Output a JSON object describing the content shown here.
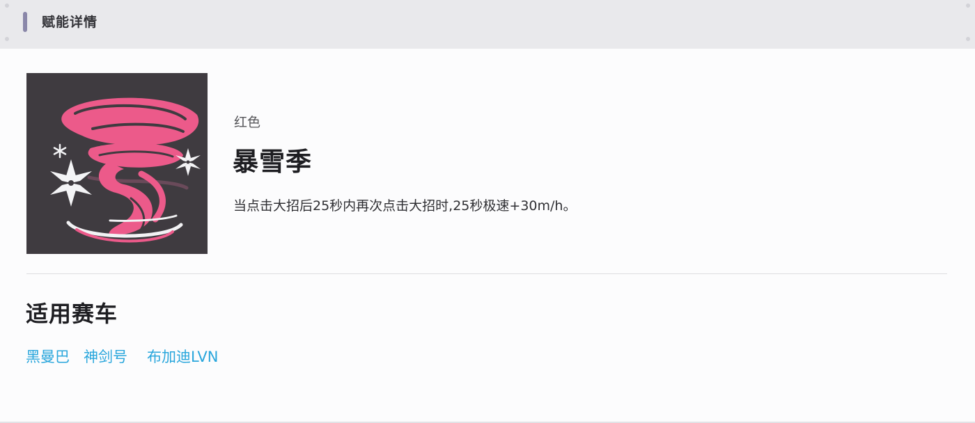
{
  "header": {
    "title": "赋能详情"
  },
  "ability": {
    "icon": "pink-tornado-snowflake-icon",
    "rarity": "红色",
    "name": "暴雪季",
    "description": "当点击大招后25秒内再次点击大招时,25秒极速+30m/h。"
  },
  "applicable_cars": {
    "title": "适用赛车",
    "cars": [
      "黑曼巴",
      "神剑号",
      "布加迪LVN"
    ]
  },
  "colors": {
    "header_bg": "#e9e9ec",
    "accent_bar": "#8a87a9",
    "link": "#29a6dc",
    "emblem_bg": "#3f3b40",
    "tornado_pink": "#ec5a8a"
  }
}
